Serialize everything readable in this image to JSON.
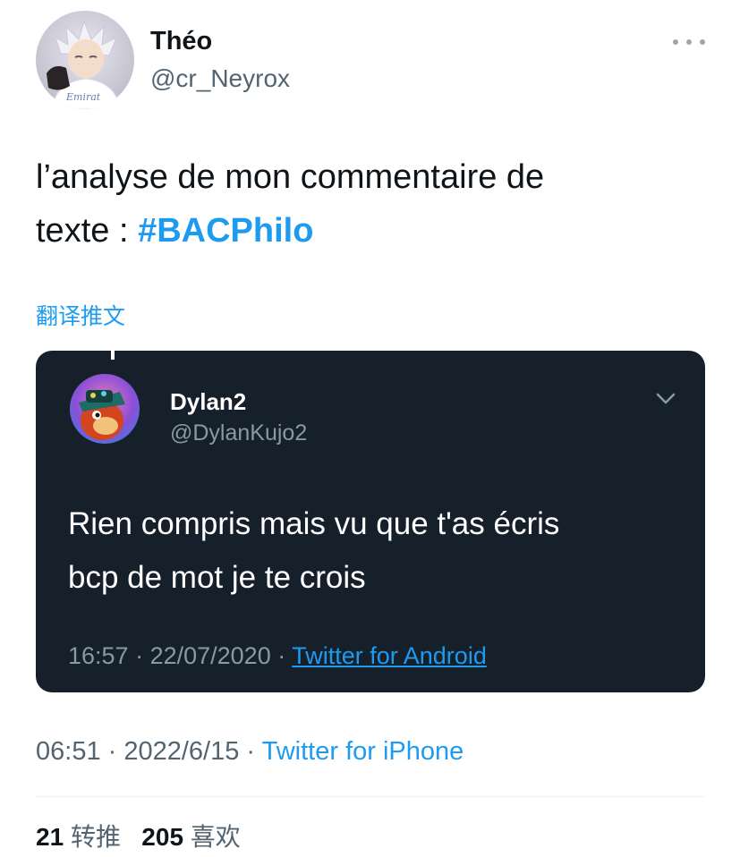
{
  "author": {
    "display_name": "Théo",
    "handle": "@cr_Neyrox",
    "avatar_icon": "anime-avatar-icon"
  },
  "more_icon": "more-horizontal-icon",
  "tweet": {
    "text_line1": "l’analyse de mon commentaire de",
    "text_line2": "texte : ",
    "hashtag": "#BACPhilo",
    "translate_label": "翻译推文"
  },
  "embedded_tweet": {
    "display_name": "Dylan2",
    "handle": "@DylanKujo2",
    "text_line1": "Rien compris mais vu que t'as écris",
    "text_line2": "bcp de mot je te crois",
    "time": "16:57",
    "date": "22/07/2020",
    "separator": " · ",
    "source": "Twitter for Android",
    "avatar_icon": "crash-bandicoot-avatar-icon",
    "chevron_icon": "chevron-down-icon",
    "background_color": "#15202b"
  },
  "meta": {
    "time": "06:51",
    "date": "2022/6/15",
    "separator": " · ",
    "source": "Twitter for iPhone"
  },
  "stats": {
    "retweets_count": "21",
    "retweets_label": "转推",
    "likes_count": "205",
    "likes_label": "喜欢"
  },
  "colors": {
    "accent": "#1d9bf0",
    "text": "#0f1419",
    "secondary": "#536471"
  }
}
